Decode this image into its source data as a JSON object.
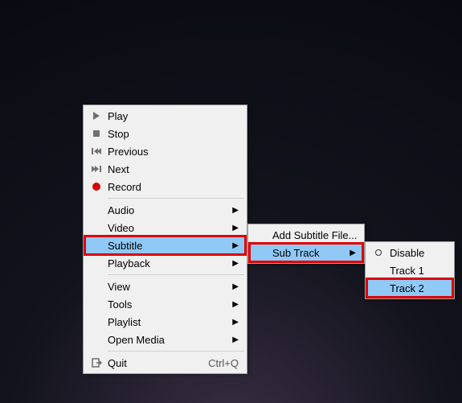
{
  "main_menu": {
    "play": "Play",
    "stop": "Stop",
    "previous": "Previous",
    "next": "Next",
    "record": "Record",
    "audio": "Audio",
    "video": "Video",
    "subtitle": "Subtitle",
    "playback": "Playback",
    "view": "View",
    "tools": "Tools",
    "playlist": "Playlist",
    "open_media": "Open Media",
    "quit": "Quit",
    "quit_shortcut": "Ctrl+Q"
  },
  "subtitle_menu": {
    "add_file": "Add Subtitle File...",
    "sub_track": "Sub Track"
  },
  "track_menu": {
    "disable": "Disable",
    "track1": "Track 1",
    "track2": "Track 2"
  }
}
